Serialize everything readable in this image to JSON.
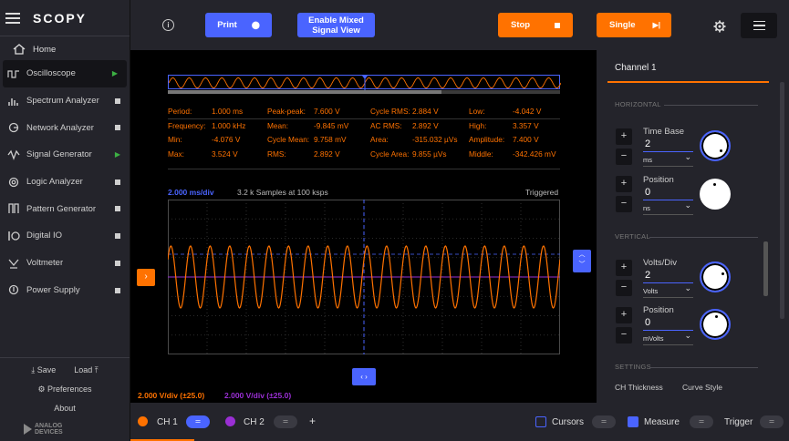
{
  "app": {
    "logo": "SCOPY"
  },
  "sidebar": {
    "home": "Home",
    "items": [
      {
        "label": "Oscilloscope",
        "status": "running",
        "icon": "oscilloscope-icon"
      },
      {
        "label": "Spectrum Analyzer",
        "status": "stopped",
        "icon": "spectrum-icon"
      },
      {
        "label": "Network Analyzer",
        "status": "stopped",
        "icon": "network-icon"
      },
      {
        "label": "Signal Generator",
        "status": "running",
        "icon": "signal-generator-icon"
      },
      {
        "label": "Logic Analyzer",
        "status": "stopped",
        "icon": "logic-icon"
      },
      {
        "label": "Pattern Generator",
        "status": "stopped",
        "icon": "pattern-icon"
      },
      {
        "label": "Digital IO",
        "status": "stopped",
        "icon": "digital-io-icon"
      },
      {
        "label": "Voltmeter",
        "status": "stopped",
        "icon": "voltmeter-icon"
      },
      {
        "label": "Power Supply",
        "status": "stopped",
        "icon": "power-icon"
      }
    ],
    "save": "Save",
    "load": "Load",
    "preferences": "Preferences",
    "about": "About",
    "brand_line1": "ANALOG",
    "brand_line2": "DEVICES"
  },
  "toolbar": {
    "print": "Print",
    "mixed_line1": "Enable Mixed",
    "mixed_line2": "Signal View",
    "stop": "Stop",
    "single": "Single"
  },
  "measurements": {
    "col1": [
      {
        "label": "Period:",
        "value": "1.000 ms"
      },
      {
        "label": "Frequency:",
        "value": "1.000 kHz"
      },
      {
        "label": "Min:",
        "value": "-4.076 V"
      },
      {
        "label": "Max:",
        "value": "3.524 V"
      }
    ],
    "col2": [
      {
        "label": "Peak-peak:",
        "value": "7.600 V"
      },
      {
        "label": "Mean:",
        "value": "-9.845 mV"
      },
      {
        "label": "Cycle Mean:",
        "value": "9.758 mV"
      },
      {
        "label": "RMS:",
        "value": "2.892 V"
      }
    ],
    "col3": [
      {
        "label": "Cycle RMS:",
        "value": "2.884 V"
      },
      {
        "label": "AC RMS:",
        "value": "2.892 V"
      },
      {
        "label": "Area:",
        "value": "-315.032 µVs"
      },
      {
        "label": "Cycle Area:",
        "value": "9.855 µVs"
      }
    ],
    "col4": [
      {
        "label": "Low:",
        "value": "-4.042 V"
      },
      {
        "label": "High:",
        "value": "3.357 V"
      },
      {
        "label": "Amplitude:",
        "value": "7.400 V"
      },
      {
        "label": "Middle:",
        "value": "-342.426 mV"
      }
    ]
  },
  "plot": {
    "time_div": "2.000 ms/div",
    "samples": "3.2 k Samples at 100 ksps",
    "trigger_status": "Triggered",
    "ch1_scale": "2.000 V/div (±25.0)",
    "ch2_scale": "2.000 V/div (±25.0)",
    "waveform_cycles": 20
  },
  "panel": {
    "channel_title": "Channel 1",
    "horizontal": "HORIZONTAL",
    "time_base_label": "Time Base",
    "time_base_value": "2",
    "time_base_unit": "ms",
    "h_position_label": "Position",
    "h_position_value": "0",
    "h_position_unit": "ns",
    "vertical": "VERTICAL",
    "volts_div_label": "Volts/Div",
    "volts_div_value": "2",
    "volts_div_unit": "Volts",
    "v_position_label": "Position",
    "v_position_value": "0",
    "v_position_unit": "mVolts",
    "settings": "SETTINGS",
    "ch_thickness": "CH Thickness",
    "curve_style": "Curve Style"
  },
  "bottombar": {
    "ch1": "CH 1",
    "ch2": "CH 2",
    "add": "+",
    "cursors": "Cursors",
    "measure": "Measure",
    "trigger": "Trigger"
  },
  "colors": {
    "accent_blue": "#4a64ff",
    "accent_orange": "#ff7200",
    "ch2_purple": "#9a2fd4"
  }
}
